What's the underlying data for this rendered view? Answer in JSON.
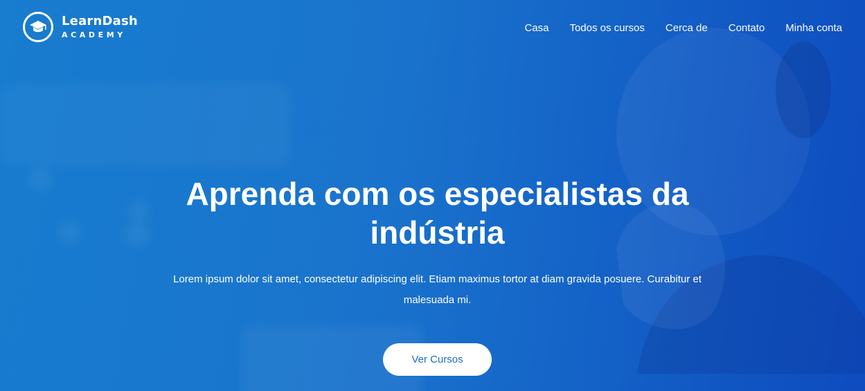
{
  "brand": {
    "name": "LearnDash",
    "subtitle": "ACADEMY",
    "icon": "graduation-cap-icon"
  },
  "nav": {
    "items": [
      {
        "label": "Casa"
      },
      {
        "label": "Todos os cursos"
      },
      {
        "label": "Cerca de"
      },
      {
        "label": "Contato"
      },
      {
        "label": "Minha conta"
      }
    ]
  },
  "hero": {
    "headline": "Aprenda com os especialistas da indústria",
    "description": "Lorem ipsum dolor sit amet, consectetur adipiscing elit. Etiam maximus tortor at diam gravida posuere. Curabitur et malesuada mi.",
    "cta_label": "Ver Cursos"
  },
  "colors": {
    "background": "#1a74cc",
    "text": "#ffffff",
    "button_bg": "#ffffff",
    "button_text": "#1d6cc2"
  }
}
